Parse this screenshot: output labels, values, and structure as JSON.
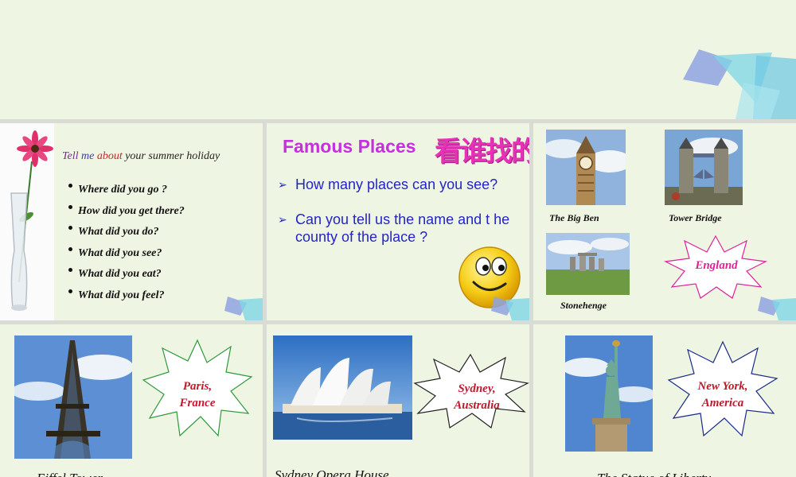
{
  "slide1": {
    "heading": {
      "tell": "Tell",
      "me": "me",
      "about": "about",
      "rest": "your summer holiday"
    },
    "questions": [
      "Where did you go ?",
      "How did you get there?",
      "What did you do?",
      "What did you see?",
      "What did you eat?",
      "What did you feel?"
    ]
  },
  "slide2": {
    "title": "Famous Places",
    "title_cn": "看谁找的多",
    "bullets": [
      "How many places can you see?",
      "Can you tell us the name and t he county of the place ?"
    ]
  },
  "slide3": {
    "captions": {
      "big_ben": "The Big Ben",
      "tower_bridge": "Tower Bridge",
      "stonehenge": "Stonehenge"
    },
    "country": "England"
  },
  "slide4": {
    "star_line1": "Paris,",
    "star_line2": "France",
    "caption": "Eiffel Tower"
  },
  "slide5": {
    "star_line1": "Sydney,",
    "star_line2": "Australia",
    "caption": "Sydney Opera House"
  },
  "slide6": {
    "star_line1": "New York,",
    "star_line2": "America",
    "caption": "The Statue of Liberty"
  },
  "colors": {
    "background": "#eef5e2",
    "title_magenta": "#c72ee0",
    "bullet_blue": "#2424c8",
    "star_red": "#c0182c",
    "england_magenta": "#e0209a"
  }
}
